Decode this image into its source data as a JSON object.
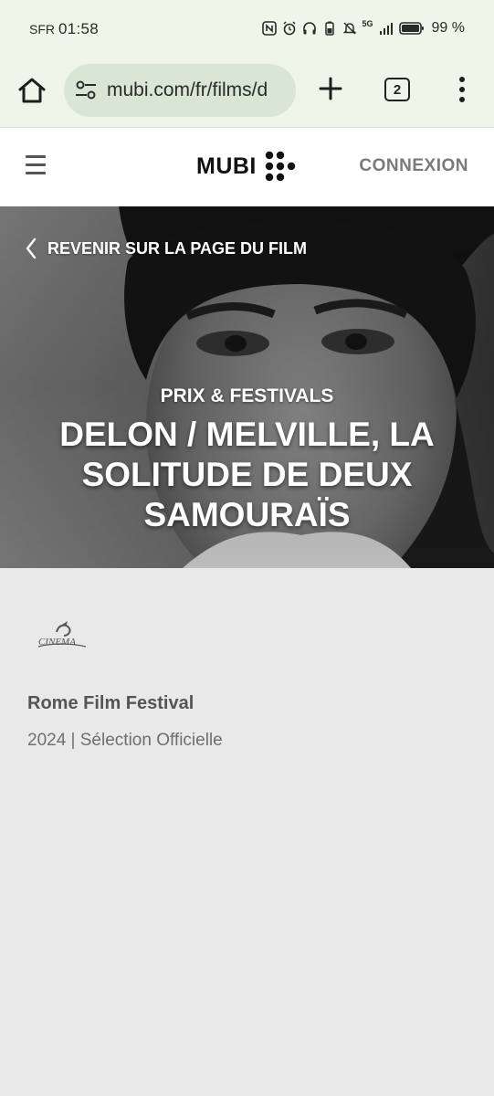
{
  "status_bar": {
    "carrier": "SFR",
    "time": "01:58",
    "network": "5G",
    "battery": "99 %"
  },
  "browser": {
    "url": "mubi.com/fr/films/d",
    "tab_count": "2"
  },
  "header": {
    "logo_text": "MUBI",
    "login": "CONNEXION"
  },
  "hero": {
    "back_link": "REVENIR SUR LA PAGE DU FILM",
    "category": "PRIX & FESTIVALS",
    "title": "DELON / MELVILLE, LA SOLITUDE DE DEUX SAMOURAÏS"
  },
  "festival": {
    "logo_text": "CINEMA",
    "name": "Rome Film Festival",
    "selection": "2024 | Sélection Officielle"
  }
}
